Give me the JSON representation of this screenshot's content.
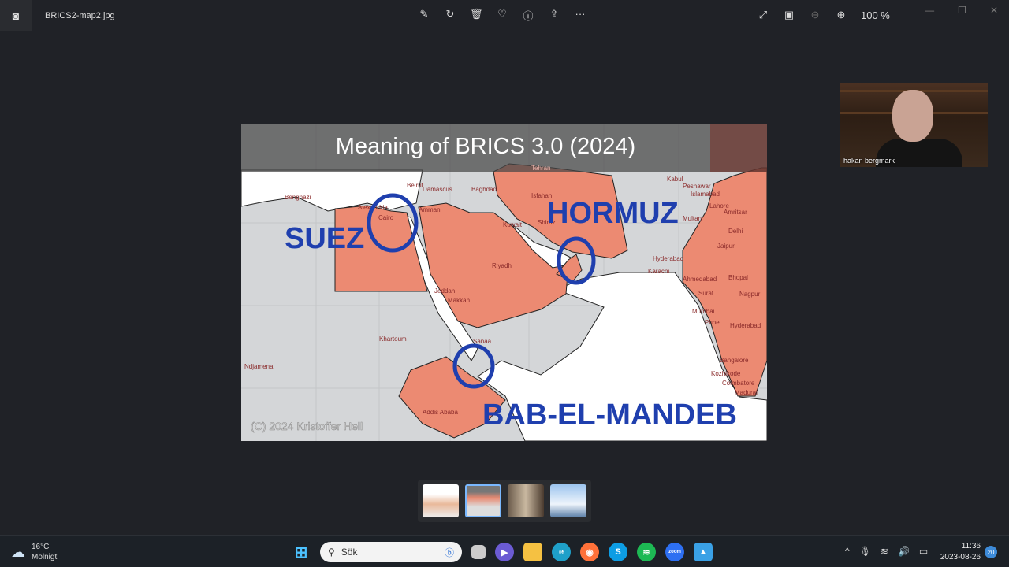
{
  "window": {
    "file_name": "BRICS2-map2.jpg",
    "zoom": "100 %"
  },
  "toolbar": {
    "icons": [
      "edit-icon",
      "rotate-icon",
      "delete-icon",
      "favorite-icon",
      "info-icon",
      "share-icon",
      "more-icon"
    ],
    "more": "···"
  },
  "slide": {
    "title": "Meaning of BRICS 3.0 (2024)",
    "labels": {
      "suez": "SUEZ",
      "hormuz": "HORMUZ",
      "bab": "BAB-EL-MANDEB"
    },
    "copyright": "(C) 2024 Kristoffer Hell",
    "cities": [
      "Benghazi",
      "Alexandria",
      "Cairo",
      "Beirut",
      "Damascus",
      "Baghdad",
      "Amman",
      "Tehran",
      "Isfahan",
      "Kuwait",
      "Shiraz",
      "Riyadh",
      "Jeddah",
      "Makkah",
      "Khartoum",
      "Sanaa",
      "Addis Ababa",
      "Ndjamena",
      "Kabul",
      "Peshawar",
      "Islamabad",
      "Lahore",
      "Amritsar",
      "Multan",
      "Delhi",
      "Jaipur",
      "Hyderabad",
      "Karachi",
      "Ahmedabad",
      "Bhopal",
      "Surat",
      "Nagpur",
      "Mumbai",
      "Pune",
      "Hyderabad",
      "Bangalore",
      "Kozhikode",
      "Coimbatore",
      "Madurai"
    ],
    "colors": {
      "brics": "#ec8a72",
      "land": "#d4d6d8",
      "sea": "#ffffff",
      "circle": "#1f3fae"
    }
  },
  "webcam": {
    "name": "hakan bergmark"
  },
  "taskbar": {
    "temp": "16°C",
    "weather": "Molnigt",
    "search": "Sök",
    "time": "11:36",
    "date": "2023-08-26",
    "notifications": "20"
  }
}
